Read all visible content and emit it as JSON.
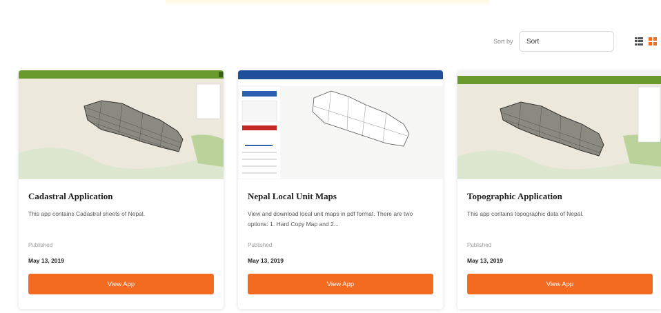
{
  "toolbar": {
    "sort_label": "Sort by",
    "sort_value": "Sort",
    "list_view_icon": "list-view-icon",
    "grid_view_icon": "grid-view-icon",
    "accent_color": "#f26b21"
  },
  "cards": [
    {
      "title": "Cadastral Application",
      "description": "This app contains Cadastral sheets of Nepal.",
      "published_label": "Published",
      "published_date": "May 13, 2019",
      "button_label": "View App"
    },
    {
      "title": "Nepal Local Unit Maps",
      "description": "View and download local unit maps in pdf format. There are two options: 1. Hard Copy Map and 2...",
      "published_label": "Published",
      "published_date": "May 13, 2019",
      "button_label": "View App"
    },
    {
      "title": "Topographic Application",
      "description": "This app contains topographic data of Nepal.",
      "published_label": "Published",
      "published_date": "May 13, 2019",
      "button_label": "View App"
    }
  ]
}
